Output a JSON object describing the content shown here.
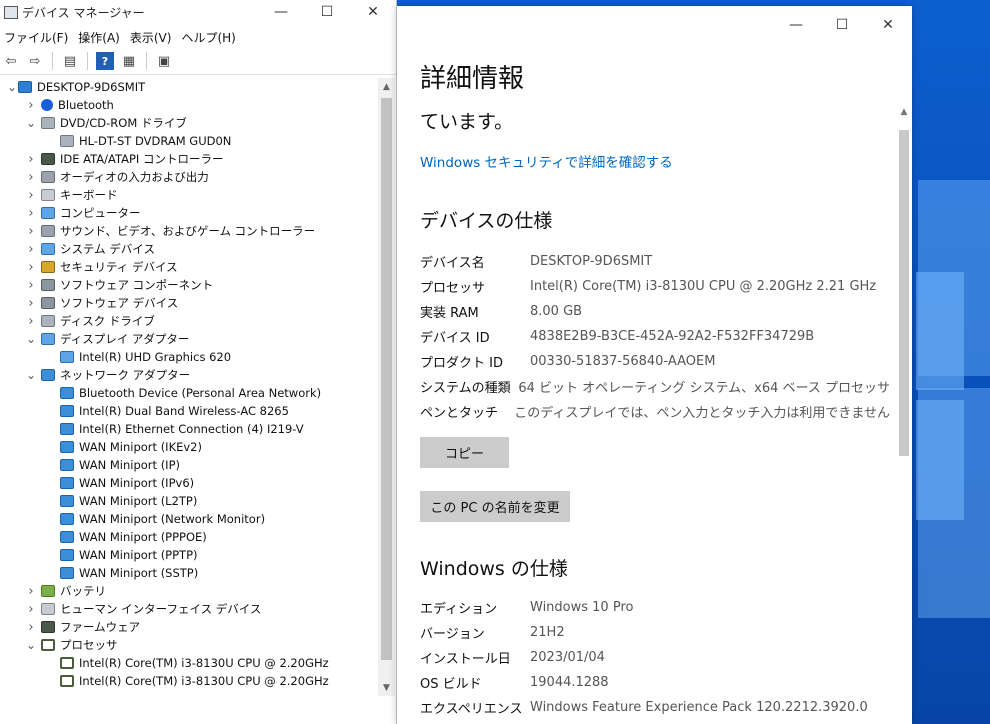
{
  "device_manager": {
    "title": "デバイス マネージャー",
    "window_controls": {
      "minimize": "—",
      "maximize": "☐",
      "close": "✕"
    },
    "menu": [
      "ファイル(F)",
      "操作(A)",
      "表示(V)",
      "ヘルプ(H)"
    ],
    "toolbar_icons": [
      "back-icon",
      "forward-icon",
      "properties-icon",
      "help-icon",
      "view-icon",
      "monitor-icon"
    ],
    "tree": [
      {
        "label": "DESKTOP-9D6SMIT",
        "level": 0,
        "expander": "down",
        "icon": "computer"
      },
      {
        "label": "Bluetooth",
        "level": 1,
        "expander": "right",
        "icon": "bt"
      },
      {
        "label": "DVD/CD-ROM ドライブ",
        "level": 1,
        "expander": "down",
        "icon": "disk"
      },
      {
        "label": "HL-DT-ST DVDRAM GUD0N",
        "level": 2,
        "expander": "",
        "icon": "disk"
      },
      {
        "label": "IDE ATA/ATAPI コントローラー",
        "level": 1,
        "expander": "right",
        "icon": "chip"
      },
      {
        "label": "オーディオの入力および出力",
        "level": 1,
        "expander": "right",
        "icon": "speaker"
      },
      {
        "label": "キーボード",
        "level": 1,
        "expander": "right",
        "icon": "key"
      },
      {
        "label": "コンピューター",
        "level": 1,
        "expander": "right",
        "icon": "display"
      },
      {
        "label": "サウンド、ビデオ、およびゲーム コントローラー",
        "level": 1,
        "expander": "right",
        "icon": "speaker"
      },
      {
        "label": "システム デバイス",
        "level": 1,
        "expander": "right",
        "icon": "display"
      },
      {
        "label": "セキュリティ デバイス",
        "level": 1,
        "expander": "right",
        "icon": "security"
      },
      {
        "label": "ソフトウェア コンポーネント",
        "level": 1,
        "expander": "right",
        "icon": "generic"
      },
      {
        "label": "ソフトウェア デバイス",
        "level": 1,
        "expander": "right",
        "icon": "generic"
      },
      {
        "label": "ディスク ドライブ",
        "level": 1,
        "expander": "right",
        "icon": "disk"
      },
      {
        "label": "ディスプレイ アダプター",
        "level": 1,
        "expander": "down",
        "icon": "display"
      },
      {
        "label": "Intel(R) UHD Graphics 620",
        "level": 2,
        "expander": "",
        "icon": "display"
      },
      {
        "label": "ネットワーク アダプター",
        "level": 1,
        "expander": "down",
        "icon": "net"
      },
      {
        "label": "Bluetooth Device (Personal Area Network)",
        "level": 2,
        "expander": "",
        "icon": "net"
      },
      {
        "label": "Intel(R) Dual Band Wireless-AC 8265",
        "level": 2,
        "expander": "",
        "icon": "net"
      },
      {
        "label": "Intel(R) Ethernet Connection (4) I219-V",
        "level": 2,
        "expander": "",
        "icon": "net"
      },
      {
        "label": "WAN Miniport (IKEv2)",
        "level": 2,
        "expander": "",
        "icon": "net"
      },
      {
        "label": "WAN Miniport (IP)",
        "level": 2,
        "expander": "",
        "icon": "net"
      },
      {
        "label": "WAN Miniport (IPv6)",
        "level": 2,
        "expander": "",
        "icon": "net"
      },
      {
        "label": "WAN Miniport (L2TP)",
        "level": 2,
        "expander": "",
        "icon": "net"
      },
      {
        "label": "WAN Miniport (Network Monitor)",
        "level": 2,
        "expander": "",
        "icon": "net"
      },
      {
        "label": "WAN Miniport (PPPOE)",
        "level": 2,
        "expander": "",
        "icon": "net"
      },
      {
        "label": "WAN Miniport (PPTP)",
        "level": 2,
        "expander": "",
        "icon": "net"
      },
      {
        "label": "WAN Miniport (SSTP)",
        "level": 2,
        "expander": "",
        "icon": "net"
      },
      {
        "label": "バッテリ",
        "level": 1,
        "expander": "right",
        "icon": "battery"
      },
      {
        "label": "ヒューマン インターフェイス デバイス",
        "level": 1,
        "expander": "right",
        "icon": "key"
      },
      {
        "label": "ファームウェア",
        "level": 1,
        "expander": "right",
        "icon": "chip"
      },
      {
        "label": "プロセッサ",
        "level": 1,
        "expander": "down",
        "icon": "cpu"
      },
      {
        "label": "Intel(R) Core(TM) i3-8130U CPU @ 2.20GHz",
        "level": 2,
        "expander": "",
        "icon": "cpu"
      },
      {
        "label": "Intel(R) Core(TM) i3-8130U CPU @ 2.20GHz",
        "level": 2,
        "expander": "",
        "icon": "cpu"
      }
    ]
  },
  "about": {
    "window_controls": {
      "minimize": "—",
      "maximize": "☐",
      "close": "✕"
    },
    "title": "詳細情報",
    "protection_text": "ています。",
    "security_link": "Windows セキュリティで詳細を確認する",
    "device_spec_heading": "デバイスの仕様",
    "device_specs": [
      {
        "key": "デバイス名",
        "value": "DESKTOP-9D6SMIT"
      },
      {
        "key": "プロセッサ",
        "value": "Intel(R) Core(TM) i3-8130U CPU @ 2.20GHz   2.21 GHz"
      },
      {
        "key": "実装 RAM",
        "value": "8.00 GB"
      },
      {
        "key": "デバイス ID",
        "value": "4838E2B9-B3CE-452A-92A2-F532FF34729B"
      },
      {
        "key": "プロダクト ID",
        "value": "00330-51837-56840-AAOEM"
      },
      {
        "key": "システムの種類",
        "value": "64 ビット オペレーティング システム、x64 ベース プロセッサ"
      },
      {
        "key": "ペンとタッチ",
        "value": "このディスプレイでは、ペン入力とタッチ入力は利用できません"
      }
    ],
    "copy_button": "コピー",
    "rename_button": "この PC の名前を変更",
    "windows_spec_heading": "Windows の仕様",
    "windows_specs": [
      {
        "key": "エディション",
        "value": "Windows 10 Pro"
      },
      {
        "key": "バージョン",
        "value": "21H2"
      },
      {
        "key": "インストール日",
        "value": "2023/01/04"
      },
      {
        "key": "OS ビルド",
        "value": "19044.1288"
      },
      {
        "key": "エクスペリエンス",
        "value": "Windows Feature Experience Pack 120.2212.3920.0"
      }
    ]
  }
}
